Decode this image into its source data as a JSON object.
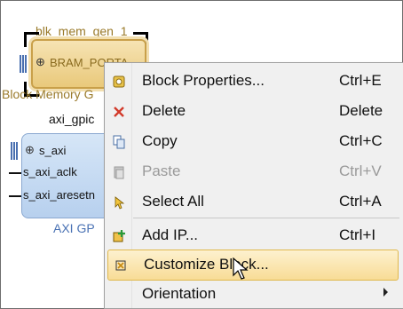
{
  "canvas": {
    "bram_block": {
      "title": "blk_mem_gen_1",
      "port_label": "BRAM_PORTA",
      "subtitle": "Block Memory G"
    },
    "axi_block": {
      "title": "axi_gpic",
      "ports": [
        "s_axi",
        "s_axi_aclk",
        "s_axi_aresetn"
      ],
      "subtitle": "AXI GP"
    }
  },
  "context_menu": {
    "items": [
      {
        "icon": "block-properties-icon",
        "label": "Block Properties...",
        "shortcut": "Ctrl+E",
        "enabled": true
      },
      {
        "icon": "delete-icon",
        "label": "Delete",
        "shortcut": "Delete",
        "enabled": true
      },
      {
        "icon": "copy-icon",
        "label": "Copy",
        "shortcut": "Ctrl+C",
        "enabled": true
      },
      {
        "icon": "paste-icon",
        "label": "Paste",
        "shortcut": "Ctrl+V",
        "enabled": false
      },
      {
        "icon": "select-all-icon",
        "label": "Select All",
        "shortcut": "Ctrl+A",
        "enabled": true
      },
      {
        "icon": "add-ip-icon",
        "label": "Add IP...",
        "shortcut": "Ctrl+I",
        "enabled": true
      },
      {
        "icon": "customize-block-icon",
        "label": "Customize Block...",
        "shortcut": "",
        "enabled": true,
        "hovered": true
      },
      {
        "icon": "",
        "label": "Orientation",
        "shortcut": "",
        "enabled": true,
        "has_submenu": true
      }
    ]
  },
  "colors": {
    "menu_hover": "#f8dc96",
    "bram_fill": "#e9c97b",
    "axi_fill": "#b7d0ee",
    "delete_red": "#d23a2a"
  }
}
